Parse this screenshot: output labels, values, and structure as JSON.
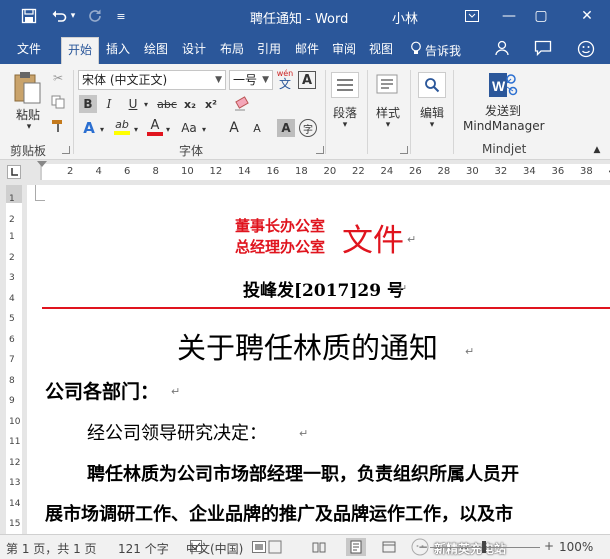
{
  "titlebar": {
    "title": "聘任通知 - Word",
    "user": "小林",
    "save_icon": "save-icon",
    "undo_icon": "undo-icon",
    "redo_icon": "redo-icon",
    "customize_icon": "customize-qat-icon",
    "minimize": "—",
    "restore": "▢",
    "close": "✕",
    "ribbon_display": "⧉"
  },
  "tabs": [
    "文件",
    "开始",
    "插入",
    "绘图",
    "设计",
    "布局",
    "引用",
    "邮件",
    "审阅",
    "视图"
  ],
  "active_tab": "开始",
  "tell_me": "告诉我",
  "ribbon": {
    "clipboard": {
      "paste_label": "粘贴",
      "group_label": "剪贴板"
    },
    "font": {
      "font_name": "宋体 (中文正文)",
      "font_size": "一号",
      "wen_label": "wén",
      "wen_char": "文",
      "A_box": "A",
      "bold": "B",
      "italic": "I",
      "underline": "U",
      "strike": "abc",
      "subscript": "x₂",
      "superscript": "x²",
      "text_effects": "A",
      "highlight": "ab",
      "font_color": "A",
      "change_case": "Aa",
      "grow": "A",
      "shrink": "A",
      "char_shading": "A",
      "enclosed": "字",
      "group_label": "字体"
    },
    "paragraph_label": "段落",
    "styles_label": "样式",
    "editing_label": "编辑",
    "mindjet": {
      "send_line1": "发送到",
      "send_line2": "MindManager",
      "group_label": "Mindjet"
    }
  },
  "ruler": {
    "h_ticks": [
      "2",
      "4",
      "6",
      "8",
      "10",
      "12",
      "14",
      "16",
      "18",
      "20",
      "22",
      "24",
      "26",
      "28",
      "30",
      "32",
      "34",
      "36",
      "38",
      "40"
    ],
    "v_ticks": [
      "1",
      "2",
      "1",
      "2",
      "3",
      "4",
      "5",
      "6",
      "7",
      "8",
      "9",
      "10",
      "11",
      "12",
      "13",
      "14",
      "15"
    ]
  },
  "document": {
    "header_line1": "董事长办公室",
    "header_line2": "总经理办公室",
    "header_big": "文件",
    "doc_number": "投峰发[2017]29 号",
    "heading": "关于聘任林质的通知",
    "salutation": "公司各部门：",
    "para1": "经公司领导研究决定：",
    "para2": "聘任林质为公司市场部经理一职，负责组织所属人员开",
    "para3": "展市场调研工作、企业品牌的推广及品牌运作工作，以及市",
    "para_mark": "↵",
    "accent_red": "#e0141e"
  },
  "status": {
    "page": "第 1 页，共 1 页",
    "words": "121 个字",
    "language": "中文(中国)",
    "zoom": "100%",
    "watermark": "新精英充电站",
    "zoom_minus": "−",
    "zoom_plus": "+"
  }
}
